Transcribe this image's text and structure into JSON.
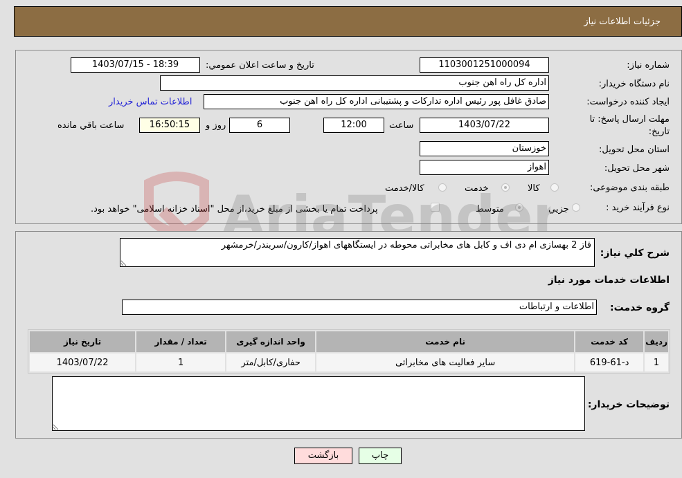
{
  "header": {
    "title": "جزئیات اطلاعات نیاز"
  },
  "form": {
    "need_number": {
      "label": "شماره نیاز:",
      "value": "1103001251000094"
    },
    "announce_datetime": {
      "label": "تاریخ و ساعت اعلان عمومي:",
      "value": "1403/07/15 - 18:39"
    },
    "buyer_org": {
      "label": "نام دستگاه خریدار:",
      "value": "اداره کل راه اهن جنوب"
    },
    "requester": {
      "label": "ایجاد کننده درخواست:",
      "value": "صادق غافل پور رئیس اداره تدارکات و پشتیبانی اداره کل راه اهن جنوب"
    },
    "buyer_contact_link": "اطلاعات تماس خریدار",
    "deadline": {
      "label_line1": "مهلت ارسال پاسخ: تا",
      "label_line2": "تاریخ:",
      "date": "1403/07/22",
      "time_label": "ساعت",
      "time": "12:00",
      "days": "6",
      "days_label": "روز و",
      "remaining": "16:50:15",
      "remaining_label": "ساعت باقي مانده"
    },
    "province": {
      "label": "استان محل تحویل:",
      "value": "خوزستان"
    },
    "city": {
      "label": "شهر محل تحویل:",
      "value": "اهواز"
    },
    "category": {
      "label": "طبقه بندی موضوعی:",
      "options": [
        "کالا",
        "خدمت",
        "کالا/خدمت"
      ],
      "selected": "خدمت"
    },
    "purchase_process": {
      "label": "نوع فرآیند خرید :",
      "options": [
        "جزيي",
        "متوسط"
      ],
      "selected": "متوسط",
      "treasury_note": "پرداخت تمام یا بخشی از مبلغ خرید،از محل \"اسناد خزانه اسلامی\" خواهد بود."
    }
  },
  "details": {
    "description_label": "شرح کلي نیاز:",
    "description": "فاز 2 بهسازی ام دی اف و کابل های مخابراتی محوطه در ایستگاههای اهواز/کارون/سربندر/خرمشهر",
    "services_heading": "اطلاعات خدمات مورد نیاز",
    "service_group_label": "گروه خدمت:",
    "service_group": "اطلاعات و ارتباطات",
    "table": {
      "headers": [
        "ردیف",
        "کد خدمت",
        "نام خدمت",
        "واحد اندازه گیری",
        "تعداد / مقدار",
        "تاریخ نیاز"
      ],
      "rows": [
        [
          "1",
          "د-61-619",
          "سایر فعالیت های مخابراتی",
          "حفاری/کابل/متر",
          "1",
          "1403/07/22"
        ]
      ]
    },
    "buyer_notes_label": "توضیحات خریدار:",
    "buyer_notes": ""
  },
  "buttons": {
    "print": "چاپ",
    "back": "بازگشت"
  },
  "watermark": "AriaTender.neT",
  "colors": {
    "header_bg": "#8c6d43",
    "print_bg": "#e6ffe6",
    "back_bg": "#ffdcdc",
    "link": "#2424d6"
  }
}
